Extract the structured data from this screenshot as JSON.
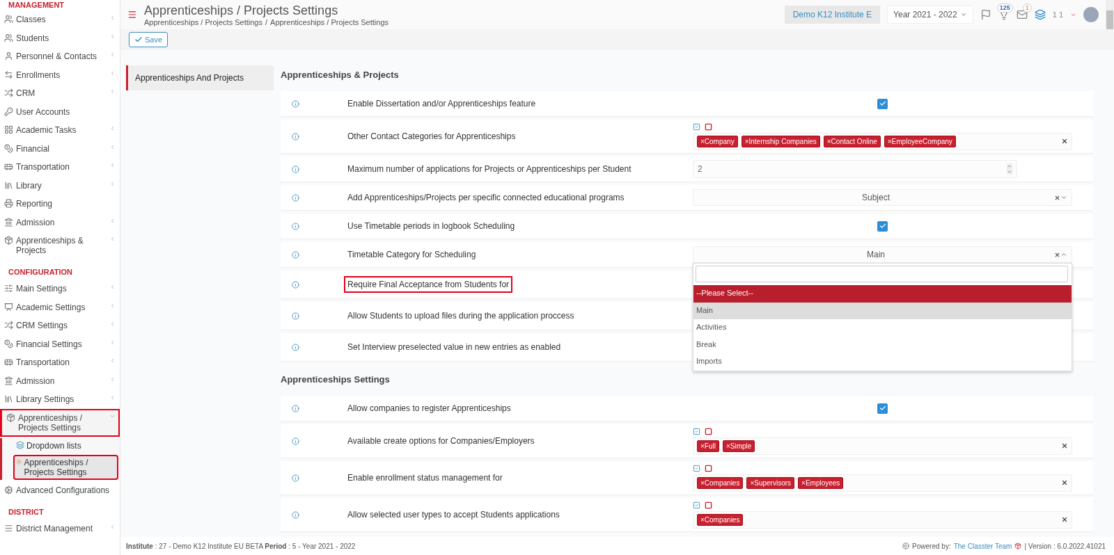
{
  "sidebar": {
    "sections": [
      {
        "title": "MANAGEMENT",
        "items": [
          {
            "label": "Classes",
            "expandable": true,
            "expanded": false,
            "annotated": false
          },
          {
            "label": "Students",
            "expandable": true,
            "expanded": false,
            "annotated": false
          },
          {
            "label": "Personnel & Contacts",
            "expandable": true,
            "expanded": false,
            "annotated": false
          },
          {
            "label": "Enrollments",
            "expandable": true,
            "expanded": false,
            "annotated": false
          },
          {
            "label": "CRM",
            "expandable": true,
            "expanded": false,
            "annotated": false
          },
          {
            "label": "User Accounts",
            "expandable": false,
            "expanded": false,
            "annotated": false
          },
          {
            "label": "Academic Tasks",
            "expandable": true,
            "expanded": false,
            "annotated": false
          },
          {
            "label": "Financial",
            "expandable": true,
            "expanded": false,
            "annotated": false
          },
          {
            "label": "Transportation",
            "expandable": true,
            "expanded": false,
            "annotated": false
          },
          {
            "label": "Library",
            "expandable": true,
            "expanded": false,
            "annotated": false
          },
          {
            "label": "Reporting",
            "expandable": false,
            "expanded": false,
            "annotated": false
          },
          {
            "label": "Admission",
            "expandable": true,
            "expanded": false,
            "annotated": false
          },
          {
            "label": "Apprenticeships & Projects",
            "expandable": true,
            "expanded": false,
            "annotated": false
          }
        ]
      },
      {
        "title": "CONFIGURATION",
        "items": [
          {
            "label": "Main Settings",
            "expandable": true,
            "expanded": false,
            "annotated": false
          },
          {
            "label": "Academic Settings",
            "expandable": true,
            "expanded": false,
            "annotated": false
          },
          {
            "label": "CRM Settings",
            "expandable": true,
            "expanded": false,
            "annotated": false
          },
          {
            "label": "Financial Settings",
            "expandable": true,
            "expanded": false,
            "annotated": false
          },
          {
            "label": "Transportation",
            "expandable": true,
            "expanded": false,
            "annotated": false
          },
          {
            "label": "Admission",
            "expandable": true,
            "expanded": false,
            "annotated": false
          },
          {
            "label": "Library Settings",
            "expandable": true,
            "expanded": false,
            "annotated": false
          },
          {
            "label": "Apprenticeships / Projects Settings",
            "expandable": true,
            "expanded": true,
            "annotated": true,
            "children": [
              {
                "label": "Dropdown lists",
                "selected": false,
                "annotated": false
              },
              {
                "label": "Apprenticeships / Projects Settings",
                "selected": true,
                "annotated": true
              }
            ]
          },
          {
            "label": "Advanced Configurations",
            "expandable": false,
            "expanded": false,
            "annotated": false
          }
        ]
      },
      {
        "title": "DISTRICT",
        "items": [
          {
            "label": "District Management",
            "expandable": true,
            "expanded": false,
            "annotated": false
          }
        ]
      }
    ]
  },
  "header": {
    "title": "Apprenticeships / Projects Settings",
    "breadcrumb": [
      "Apprenticeships / Projects Settings",
      "Apprenticeships / Projects Settings"
    ],
    "breadcrumb_separator": "/",
    "institute": "Demo K12 Institute E",
    "year": "Year 2021 - 2022",
    "notifications": "125",
    "messages": "1",
    "user": "1 1"
  },
  "toolbar": {
    "save": "Save"
  },
  "settings_nav": [
    {
      "label": "Apprenticeships And Projects",
      "selected": true
    }
  ],
  "sections": [
    {
      "title": "Apprenticeships & Projects",
      "rows": [
        {
          "label": "Enable Dissertation and/or Apprenticeships feature",
          "annotated": false,
          "kind": "checkbox",
          "checked": true
        },
        {
          "label": "Other Contact Categories for Apprenticeships",
          "annotated": false,
          "kind": "tags",
          "tags": [
            "×Company",
            "×Internship Companies",
            "×Contact Online",
            "×EmployeeCompany"
          ]
        },
        {
          "label": "Maximum number of applications for Projects or Apprenticeships per Student",
          "annotated": false,
          "kind": "number",
          "value": "2"
        },
        {
          "label": "Add Apprenticeships/Projects per specific connected educational programs",
          "annotated": false,
          "kind": "select",
          "value": "Subject",
          "open": false
        },
        {
          "label": "Use Timetable periods in logbook Scheduling",
          "annotated": false,
          "kind": "checkbox",
          "checked": true
        },
        {
          "label": "Timetable Category for Scheduling",
          "annotated": false,
          "kind": "select",
          "value": "Main",
          "open": true,
          "options": [
            {
              "label": "--Please Select--",
              "hovered": true,
              "selected": false
            },
            {
              "label": "Main",
              "hovered": false,
              "selected": true
            },
            {
              "label": "Activities",
              "hovered": false,
              "selected": false
            },
            {
              "label": "Break",
              "hovered": false,
              "selected": false
            },
            {
              "label": "Imports",
              "hovered": false,
              "selected": false
            }
          ]
        },
        {
          "label": "Require Final Acceptance from Students for",
          "annotated": true,
          "kind": "covered"
        },
        {
          "label": "Allow Students to upload files during the application proccess",
          "annotated": false,
          "kind": "covered"
        },
        {
          "label": "Set Interview preselected value in new entries as enabled",
          "annotated": false,
          "kind": "covered"
        }
      ]
    },
    {
      "title": "Apprenticeships Settings",
      "rows": [
        {
          "label": "Allow companies to register Apprenticeships",
          "annotated": false,
          "kind": "checkbox",
          "checked": true
        },
        {
          "label": "Available create options for Companies/Employers",
          "annotated": false,
          "kind": "tags",
          "tags": [
            "×Full",
            "×Simple"
          ]
        },
        {
          "label": "Enable enrollment status management for",
          "annotated": false,
          "kind": "tags",
          "tags": [
            "×Companies",
            "×Supervisors",
            "×Employees"
          ]
        },
        {
          "label": "Allow selected user types to accept Students applications",
          "annotated": false,
          "kind": "tags",
          "tags": [
            "×Companies"
          ]
        }
      ]
    }
  ],
  "footer": {
    "info": "**Institute** : 27 - Demo K12 Institute EU BETA **Period** : 5 - Year 2021 - 2022",
    "powered": "Powered by:",
    "team": "The Classter Team",
    "version": "| Version : 6.0.2022.41021"
  }
}
